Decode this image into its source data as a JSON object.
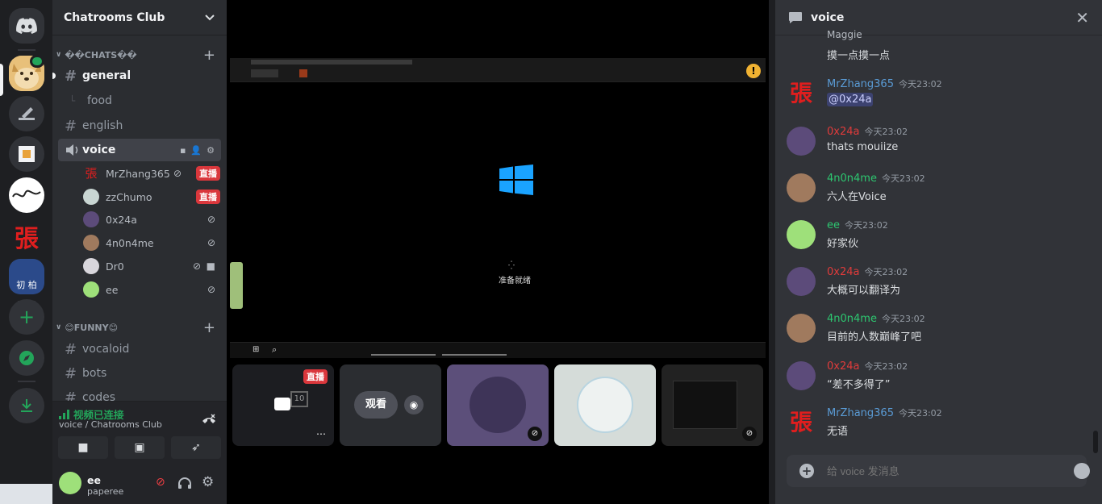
{
  "server": {
    "name": "Chatrooms Club",
    "rail_char": "張",
    "mini_labels": "初 柏"
  },
  "categories": {
    "chats": "��CHATS��",
    "funny": "😊FUNNY😊"
  },
  "channels": {
    "general": "general",
    "food": "food",
    "english": "english",
    "voice": "voice",
    "vocaloid": "vocaloid",
    "bots": "bots",
    "codes": "codes"
  },
  "voice_users": [
    {
      "name": "MrZhang365",
      "badge": "直播"
    },
    {
      "name": "zzChumo",
      "badge": "直播"
    },
    {
      "name": "0x24a",
      "badge": ""
    },
    {
      "name": "4n0n4me",
      "badge": ""
    },
    {
      "name": "Dr0",
      "badge": ""
    },
    {
      "name": "ee",
      "badge": ""
    }
  ],
  "voice_status": {
    "title": "视频已连接",
    "subtitle": "voice / Chatrooms Club"
  },
  "user": {
    "name": "ee",
    "status": "paperee"
  },
  "stage": {
    "loading_text": "准备就绪",
    "tile_live_badge": "直播",
    "watch_label": "观看",
    "tile_number": "10"
  },
  "chat": {
    "channel": "voice",
    "placeholder": "给 voice 发消息",
    "partial": {
      "name": "Maggie",
      "text": "摸一点摸一点"
    },
    "messages": [
      {
        "author": "MrZhang365",
        "time": "今天23:02",
        "text": "@0x24a",
        "color": "#5a9bd5",
        "mention": true
      },
      {
        "author": "0x24a",
        "time": "今天23:02",
        "text": "thats mouiize",
        "color": "#e03b3b"
      },
      {
        "author": "4n0n4me",
        "time": "今天23:02",
        "text": "六人在Voice",
        "color": "#2dc770"
      },
      {
        "author": "ee",
        "time": "今天23:02",
        "text": "好家伙",
        "color": "#2dc770"
      },
      {
        "author": "0x24a",
        "time": "今天23:02",
        "text": "大概可以翻译为",
        "color": "#e03b3b"
      },
      {
        "author": "4n0n4me",
        "time": "今天23:02",
        "text": "目前的人数巅峰了吧",
        "color": "#2dc770"
      },
      {
        "author": "0x24a",
        "time": "今天23:02",
        "text": "“差不多得了”",
        "color": "#e03b3b"
      },
      {
        "author": "MrZhang365",
        "time": "今天23:02",
        "text": "无语",
        "color": "#5a9bd5"
      }
    ]
  },
  "colors": {
    "accent": "#5865f2",
    "live": "#da373c",
    "connected": "#23a55a",
    "zhang_red": "#e01e1e"
  }
}
